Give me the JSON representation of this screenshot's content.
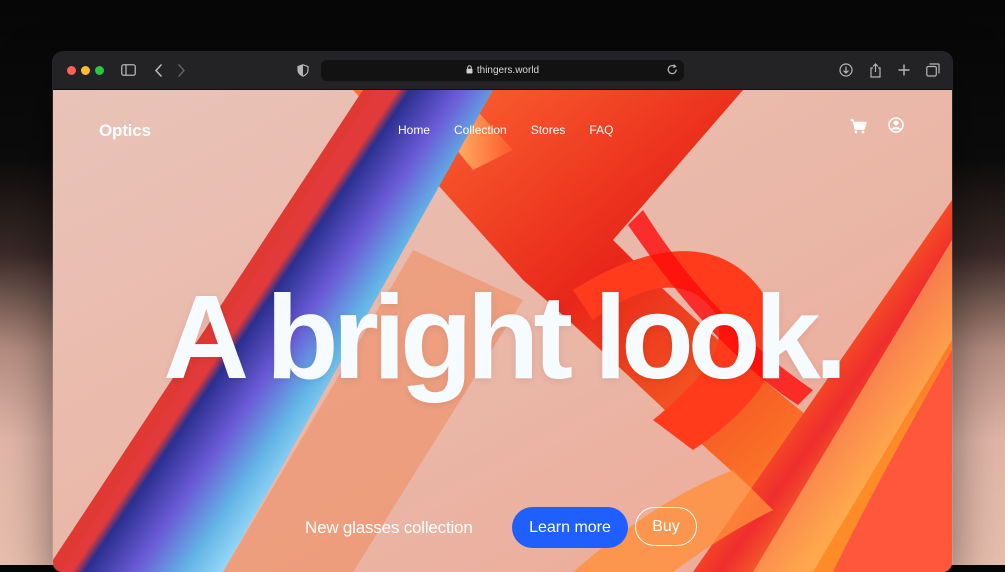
{
  "browser": {
    "url": "thingers.world",
    "icons": [
      "close-icon",
      "minimize-icon",
      "zoom-icon",
      "sidebar-icon",
      "back-icon",
      "forward-icon",
      "privacy-shield-icon",
      "lock-icon",
      "reload-icon",
      "download-icon",
      "share-icon",
      "new-tab-icon",
      "tab-overview-icon"
    ]
  },
  "site": {
    "logo": "Optics",
    "nav": [
      "Home",
      "Collection",
      "Stores",
      "FAQ"
    ],
    "icons": [
      "cart-icon",
      "account-icon"
    ]
  },
  "hero": {
    "headline": "A bright look.",
    "subtitle": "New glasses collection",
    "primary_button": "Learn more",
    "secondary_button": "Buy"
  },
  "colors": {
    "accent": "#1f5fff",
    "page_background": "#e8baa9"
  }
}
